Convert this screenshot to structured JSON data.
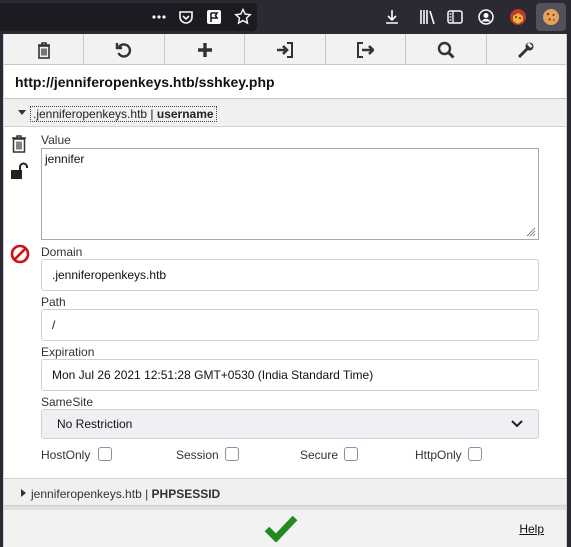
{
  "browser_toolbar": {
    "icons": [
      "more-icon",
      "pocket-icon",
      "flag-icon",
      "bookmark-star-icon",
      "download-icon",
      "library-icon",
      "sidebar-icon",
      "account-icon",
      "extension-icon",
      "cookie-icon"
    ]
  },
  "toolbar": {
    "buttons": [
      "delete-icon",
      "refresh-icon",
      "add-icon",
      "import-icon",
      "export-icon",
      "search-icon",
      "settings-icon"
    ]
  },
  "page": {
    "url": "http://jenniferopenkeys.htb/sshkey.php"
  },
  "cookie": {
    "domain_part": ".jenniferopenkeys.htb | ",
    "name_part": "username",
    "value_label": "Value",
    "value": "jennifer",
    "domain_label": "Domain",
    "domain": ".jenniferopenkeys.htb",
    "path_label": "Path",
    "path": "/",
    "expiration_label": "Expiration",
    "expiration": "Mon Jul 26 2021 12:51:28 GMT+0530 (India Standard Time)",
    "samesite_label": "SameSite",
    "samesite_value": "No Restriction",
    "hostonly_label": "HostOnly",
    "session_label": "Session",
    "secure_label": "Secure",
    "httponly_label": "HttpOnly"
  },
  "cookie2": {
    "domain_part": "jenniferopenkeys.htb | ",
    "name_part": "PHPSESSID"
  },
  "footer": {
    "help_label": "Help"
  },
  "colors": {
    "browser_bg": "#2b2a33",
    "confirm_green": "#1e8c1e",
    "block_red": "#d11010"
  }
}
